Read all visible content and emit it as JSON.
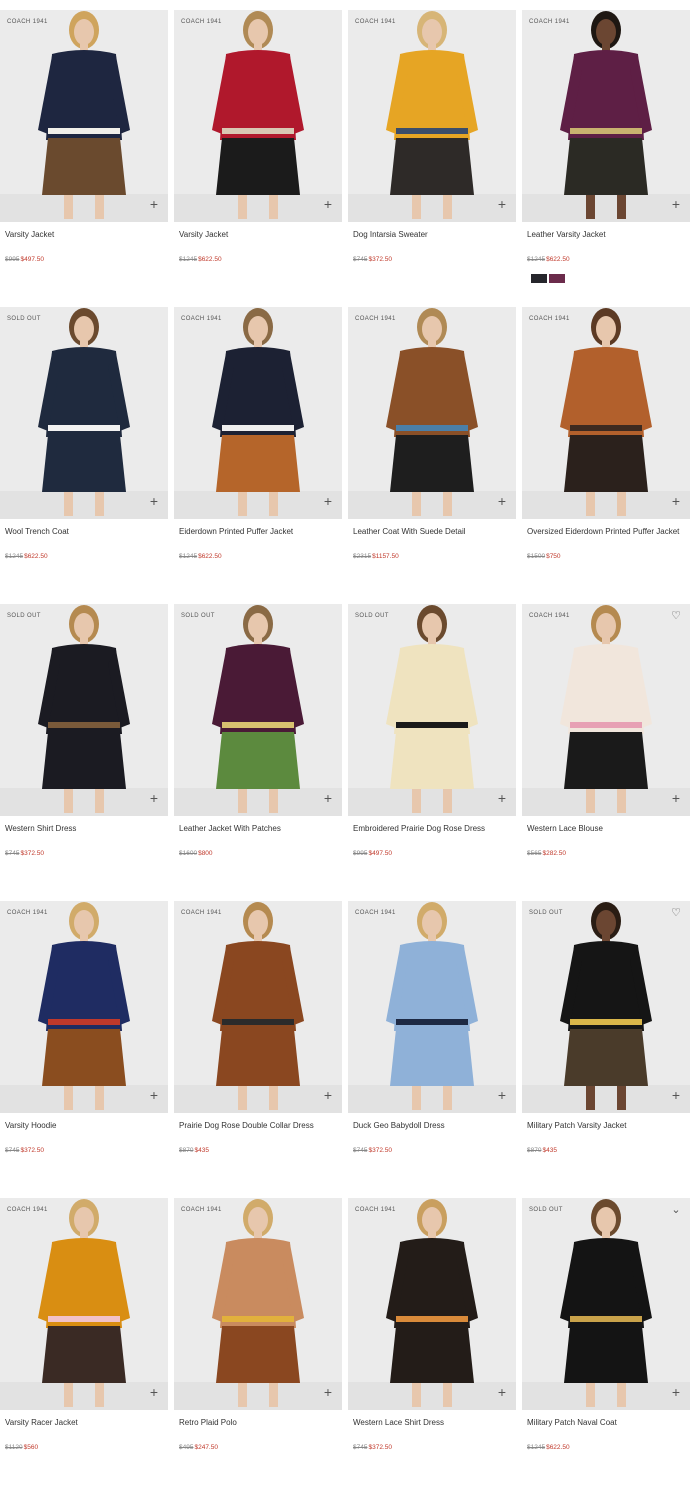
{
  "products": [
    {
      "name": "Varsity Jacket",
      "badge": "COACH 1941",
      "was": "$995",
      "now": "$497.50",
      "colors": {
        "bg": "#ebebeb",
        "top": "#1e2640",
        "bottom": "#6a4a2e",
        "skin": "#e7c7ad",
        "hair": "#cfa45d",
        "accent": "#f1efe9"
      }
    },
    {
      "name": "Varsity Jacket",
      "badge": "COACH 1941",
      "was": "$1245",
      "now": "$622.50",
      "colors": {
        "bg": "#ebebeb",
        "top": "#b0182c",
        "bottom": "#1b1b1b",
        "skin": "#e7c7ad",
        "hair": "#b08a55",
        "accent": "#d8c7b3"
      }
    },
    {
      "name": "Dog Intarsia Sweater",
      "badge": "COACH 1941",
      "was": "$745",
      "now": "$372.50",
      "colors": {
        "bg": "#ebebeb",
        "top": "#e6a524",
        "bottom": "#2e2a28",
        "skin": "#e7c7ad",
        "hair": "#d7b577",
        "accent": "#3b4d6a"
      }
    },
    {
      "name": "Leather Varsity Jacket",
      "badge": "COACH 1941",
      "was": "$1245",
      "now": "$622.50",
      "swatches": [
        {
          "name": "Black",
          "hex": "#26262c"
        },
        {
          "name": "Plum",
          "hex": "#6b2b4b"
        }
      ],
      "colors": {
        "bg": "#ebebeb",
        "top": "#5e1f45",
        "bottom": "#2b2a24",
        "skin": "#6b4632",
        "hair": "#1e1712",
        "accent": "#c9b26f"
      }
    },
    {
      "name": "Wool Trench Coat",
      "badge": "SOLD OUT",
      "was": "$1245",
      "now": "$622.50",
      "colors": {
        "bg": "#ebebeb",
        "top": "#1f2a3e",
        "bottom": "#1f2a3e",
        "skin": "#e7c7ad",
        "hair": "#6b4a2e",
        "accent": "#f2f2f2"
      }
    },
    {
      "name": "Eiderdown Printed Puffer Jacket",
      "badge": "COACH 1941",
      "was": "$1245",
      "now": "$622.50",
      "colors": {
        "bg": "#ebebeb",
        "top": "#1c2133",
        "bottom": "#b5652a",
        "skin": "#e7c7ad",
        "hair": "#8a6a45",
        "accent": "#efefef"
      }
    },
    {
      "name": "Leather Coat With Suede Detail",
      "badge": "COACH 1941",
      "was": "$2315",
      "now": "$1157.50",
      "colors": {
        "bg": "#ebebeb",
        "top": "#8a5028",
        "bottom": "#1e1e1e",
        "skin": "#e7c7ad",
        "hair": "#b08a55",
        "accent": "#4b7fa8"
      }
    },
    {
      "name": "Oversized Eiderdown Printed Puffer Jacket",
      "badge": "COACH 1941",
      "was": "$1500",
      "now": "$750",
      "colors": {
        "bg": "#ebebeb",
        "top": "#b2602c",
        "bottom": "#2b211c",
        "skin": "#e7c7ad",
        "hair": "#5c3a24",
        "accent": "#3d2a20"
      }
    },
    {
      "name": "Western Shirt Dress",
      "badge": "SOLD OUT",
      "was": "$745",
      "now": "$372.50",
      "colors": {
        "bg": "#ebebeb",
        "top": "#1b1b22",
        "bottom": "#1b1b22",
        "skin": "#e7c7ad",
        "hair": "#b58a50",
        "accent": "#7a5a3a"
      }
    },
    {
      "name": "Leather Jacket With Patches",
      "badge": "SOLD OUT",
      "was": "$1600",
      "now": "$800",
      "colors": {
        "bg": "#ebebeb",
        "top": "#4a1a36",
        "bottom": "#5c8a3e",
        "skin": "#e7c7ad",
        "hair": "#8a6a45",
        "accent": "#d9c170"
      }
    },
    {
      "name": "Embroidered Prairie Dog Rose Dress",
      "badge": "SOLD OUT",
      "was": "$995",
      "now": "$497.50",
      "colors": {
        "bg": "#ebebeb",
        "top": "#efe3bf",
        "bottom": "#efe3bf",
        "skin": "#e7c7ad",
        "hair": "#6b4a2e",
        "accent": "#1a1a1a"
      }
    },
    {
      "name": "Western Lace Blouse",
      "badge": "COACH 1941",
      "was": "$565",
      "now": "$282.50",
      "colors": {
        "bg": "#ebebeb",
        "top": "#f1e6dc",
        "bottom": "#1a1a1a",
        "skin": "#e7c7ad",
        "hair": "#b58a50",
        "accent": "#e7a0b4"
      }
    },
    {
      "name": "Varsity Hoodie",
      "badge": "COACH 1941",
      "was": "$745",
      "now": "$372.50",
      "colors": {
        "bg": "#ebebeb",
        "top": "#1f2c62",
        "bottom": "#8a4d1f",
        "skin": "#e7c7ad",
        "hair": "#d1ab6a",
        "accent": "#c0392b"
      }
    },
    {
      "name": "Prairie Dog Rose Double Collar Dress",
      "badge": "COACH 1941",
      "was": "$870",
      "now": "$435",
      "colors": {
        "bg": "#ebebeb",
        "top": "#8a4720",
        "bottom": "#8a4720",
        "skin": "#e7c7ad",
        "hair": "#b58a50",
        "accent": "#2b2b2b"
      }
    },
    {
      "name": "Duck Geo Babydoll Dress",
      "badge": "COACH 1941",
      "was": "$745",
      "now": "$372.50",
      "colors": {
        "bg": "#ebebeb",
        "top": "#8fb1d8",
        "bottom": "#8fb1d8",
        "skin": "#e7c7ad",
        "hair": "#d1ab6a",
        "accent": "#1e2a44"
      }
    },
    {
      "name": "Military Patch Varsity Jacket",
      "badge": "SOLD OUT",
      "was": "$870",
      "now": "$435",
      "colors": {
        "bg": "#ebebeb",
        "top": "#151515",
        "bottom": "#4a3b2a",
        "skin": "#6b4632",
        "hair": "#2a1d14",
        "accent": "#d9b64a"
      }
    },
    {
      "name": "Varsity Racer Jacket",
      "badge": "COACH 1941",
      "was": "$1120",
      "now": "$560",
      "colors": {
        "bg": "#ebebeb",
        "top": "#d98e12",
        "bottom": "#3a2a24",
        "skin": "#e7c7ad",
        "hair": "#d1ab6a",
        "accent": "#f2c2c8"
      }
    },
    {
      "name": "Retro Plaid Polo",
      "badge": "COACH 1941",
      "was": "$495",
      "now": "$247.50",
      "colors": {
        "bg": "#ebebeb",
        "top": "#c98b5f",
        "bottom": "#8a4720",
        "skin": "#e7c7ad",
        "hair": "#d1ab6a",
        "accent": "#e2b13c"
      }
    },
    {
      "name": "Western Lace Shirt Dress",
      "badge": "COACH 1941",
      "was": "$745",
      "now": "$372.50",
      "colors": {
        "bg": "#ebebeb",
        "top": "#231c18",
        "bottom": "#231c18",
        "skin": "#e7c7ad",
        "hair": "#c99f5f",
        "accent": "#d98a3a"
      }
    },
    {
      "name": "Military Patch Naval Coat",
      "badge": "SOLD OUT",
      "was": "$1245",
      "now": "$622.50",
      "colors": {
        "bg": "#ebebeb",
        "top": "#141414",
        "bottom": "#141414",
        "skin": "#e7c7ad",
        "hair": "#6b4a2e",
        "accent": "#c9a24a"
      }
    }
  ],
  "icons": {
    "add": "plus-icon",
    "wishlist": "heart-icon",
    "expand": "chevron-down-icon"
  }
}
